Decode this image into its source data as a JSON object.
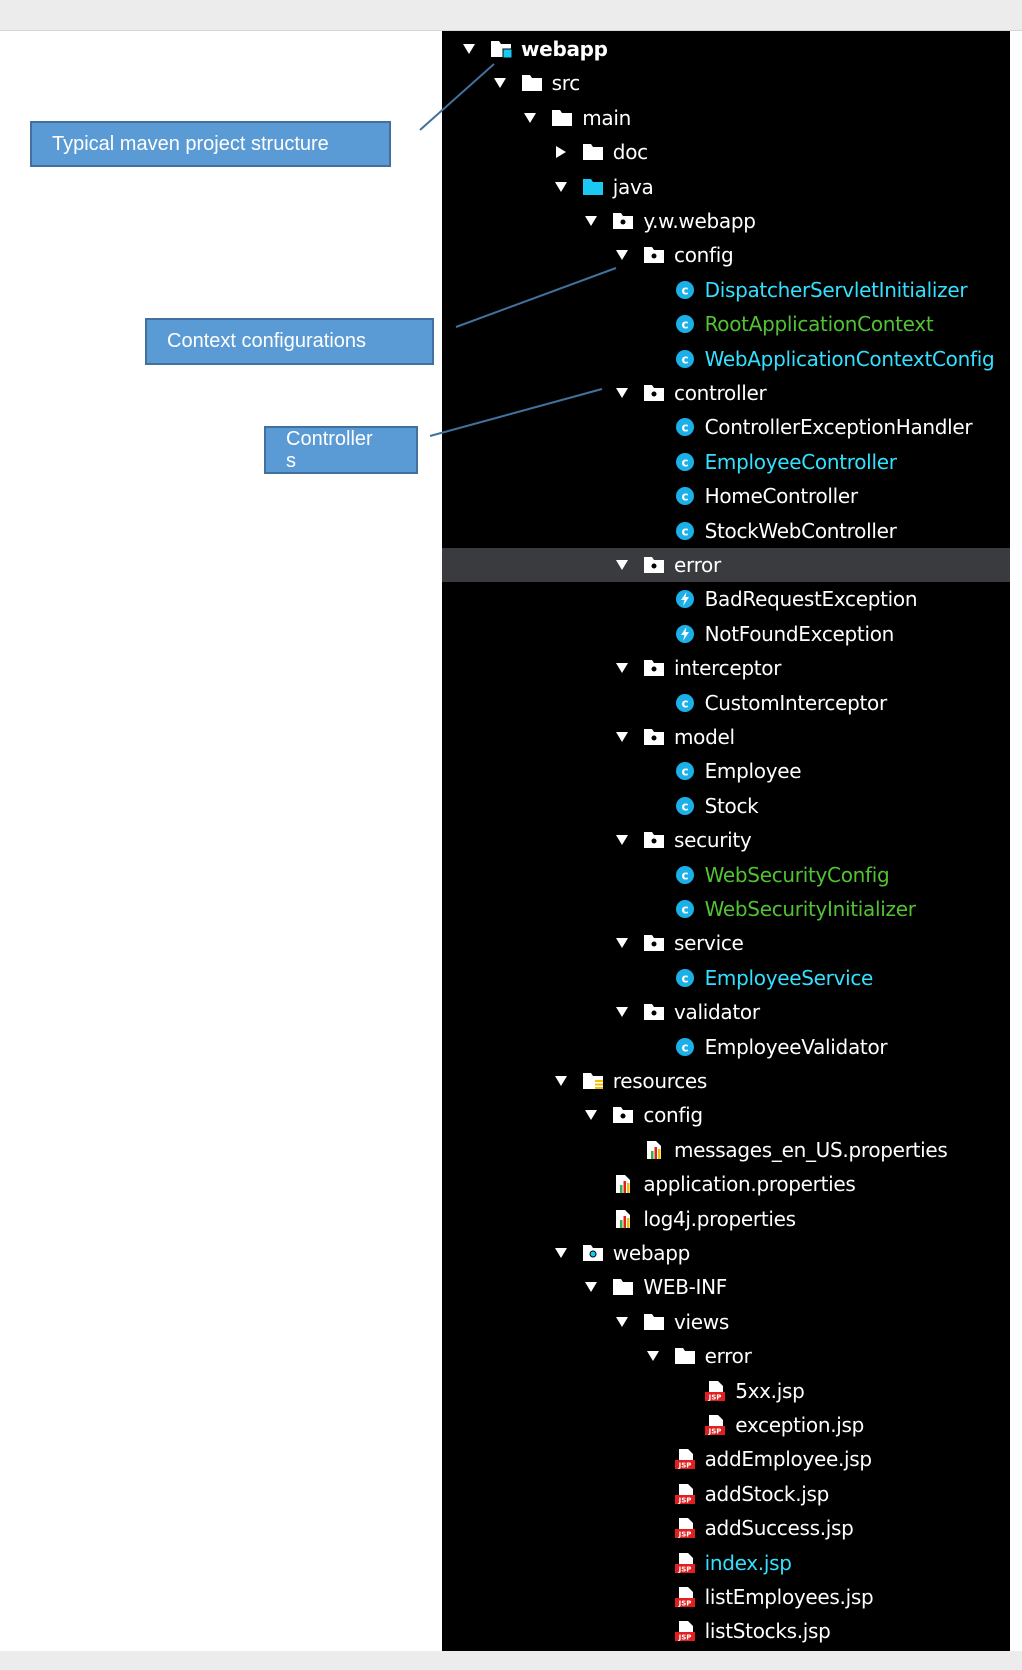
{
  "annotations": {
    "maven": "Typical maven project structure",
    "context": "Context configurations",
    "controllers": "Controller s"
  },
  "colors": {
    "panel_bg": "#000000",
    "selected_row": "#3a3b3f",
    "label_default": "#ffffff",
    "label_modified": "#34e0ff",
    "label_added": "#52c234",
    "class_icon": "#1bb0e8",
    "jsp_icon": "#e02020",
    "annotation_fill": "#5b9bd5"
  },
  "tree": [
    {
      "label": "webapp",
      "depth": 0,
      "icon": "project-folder-icon",
      "expanded": true,
      "bold": true
    },
    {
      "label": "src",
      "depth": 1,
      "icon": "folder-icon",
      "expanded": true
    },
    {
      "label": "main",
      "depth": 2,
      "icon": "folder-icon",
      "expanded": true
    },
    {
      "label": "doc",
      "depth": 3,
      "icon": "folder-icon",
      "expanded": false
    },
    {
      "label": "java",
      "depth": 3,
      "icon": "source-folder-icon",
      "expanded": true
    },
    {
      "label": "y.w.webapp",
      "depth": 4,
      "icon": "package-icon",
      "expanded": true
    },
    {
      "label": "config",
      "depth": 5,
      "icon": "package-icon",
      "expanded": true
    },
    {
      "label": "DispatcherServletInitializer",
      "depth": 6,
      "icon": "class-icon",
      "status": "modified"
    },
    {
      "label": "RootApplicationContext",
      "depth": 6,
      "icon": "class-icon",
      "status": "added"
    },
    {
      "label": "WebApplicationContextConfig",
      "depth": 6,
      "icon": "class-icon",
      "status": "modified"
    },
    {
      "label": "controller",
      "depth": 5,
      "icon": "package-icon",
      "expanded": true
    },
    {
      "label": "ControllerExceptionHandler",
      "depth": 6,
      "icon": "class-icon"
    },
    {
      "label": "EmployeeController",
      "depth": 6,
      "icon": "class-icon",
      "status": "modified"
    },
    {
      "label": "HomeController",
      "depth": 6,
      "icon": "class-icon"
    },
    {
      "label": "StockWebController",
      "depth": 6,
      "icon": "class-icon"
    },
    {
      "label": "error",
      "depth": 5,
      "icon": "package-icon",
      "expanded": true,
      "selected": true
    },
    {
      "label": "BadRequestException",
      "depth": 6,
      "icon": "exception-class-icon"
    },
    {
      "label": "NotFoundException",
      "depth": 6,
      "icon": "exception-class-icon"
    },
    {
      "label": "interceptor",
      "depth": 5,
      "icon": "package-icon",
      "expanded": true
    },
    {
      "label": "CustomInterceptor",
      "depth": 6,
      "icon": "class-icon"
    },
    {
      "label": "model",
      "depth": 5,
      "icon": "package-icon",
      "expanded": true
    },
    {
      "label": "Employee",
      "depth": 6,
      "icon": "class-icon"
    },
    {
      "label": "Stock",
      "depth": 6,
      "icon": "class-icon"
    },
    {
      "label": "security",
      "depth": 5,
      "icon": "package-icon",
      "expanded": true
    },
    {
      "label": "WebSecurityConfig",
      "depth": 6,
      "icon": "class-icon",
      "status": "added"
    },
    {
      "label": "WebSecurityInitializer",
      "depth": 6,
      "icon": "class-icon",
      "status": "added"
    },
    {
      "label": "service",
      "depth": 5,
      "icon": "package-icon",
      "expanded": true
    },
    {
      "label": "EmployeeService",
      "depth": 6,
      "icon": "class-icon",
      "status": "modified"
    },
    {
      "label": "validator",
      "depth": 5,
      "icon": "package-icon",
      "expanded": true
    },
    {
      "label": "EmployeeValidator",
      "depth": 6,
      "icon": "class-icon"
    },
    {
      "label": "resources",
      "depth": 3,
      "icon": "resources-folder-icon",
      "expanded": true
    },
    {
      "label": "config",
      "depth": 4,
      "icon": "package-icon",
      "expanded": true
    },
    {
      "label": "messages_en_US.properties",
      "depth": 5,
      "icon": "properties-file-icon"
    },
    {
      "label": "application.properties",
      "depth": 4,
      "icon": "properties-file-icon"
    },
    {
      "label": "log4j.properties",
      "depth": 4,
      "icon": "properties-file-icon"
    },
    {
      "label": "webapp",
      "depth": 3,
      "icon": "web-folder-icon",
      "expanded": true
    },
    {
      "label": "WEB-INF",
      "depth": 4,
      "icon": "folder-icon",
      "expanded": true
    },
    {
      "label": "views",
      "depth": 5,
      "icon": "folder-icon",
      "expanded": true
    },
    {
      "label": "error",
      "depth": 6,
      "icon": "folder-icon",
      "expanded": true
    },
    {
      "label": "5xx.jsp",
      "depth": 7,
      "icon": "jsp-file-icon"
    },
    {
      "label": "exception.jsp",
      "depth": 7,
      "icon": "jsp-file-icon"
    },
    {
      "label": "addEmployee.jsp",
      "depth": 6,
      "icon": "jsp-file-icon"
    },
    {
      "label": "addStock.jsp",
      "depth": 6,
      "icon": "jsp-file-icon"
    },
    {
      "label": "addSuccess.jsp",
      "depth": 6,
      "icon": "jsp-file-icon"
    },
    {
      "label": "index.jsp",
      "depth": 6,
      "icon": "jsp-file-icon",
      "status": "modified"
    },
    {
      "label": "listEmployees.jsp",
      "depth": 6,
      "icon": "jsp-file-icon"
    },
    {
      "label": "listStocks.jsp",
      "depth": 6,
      "icon": "jsp-file-icon"
    }
  ]
}
